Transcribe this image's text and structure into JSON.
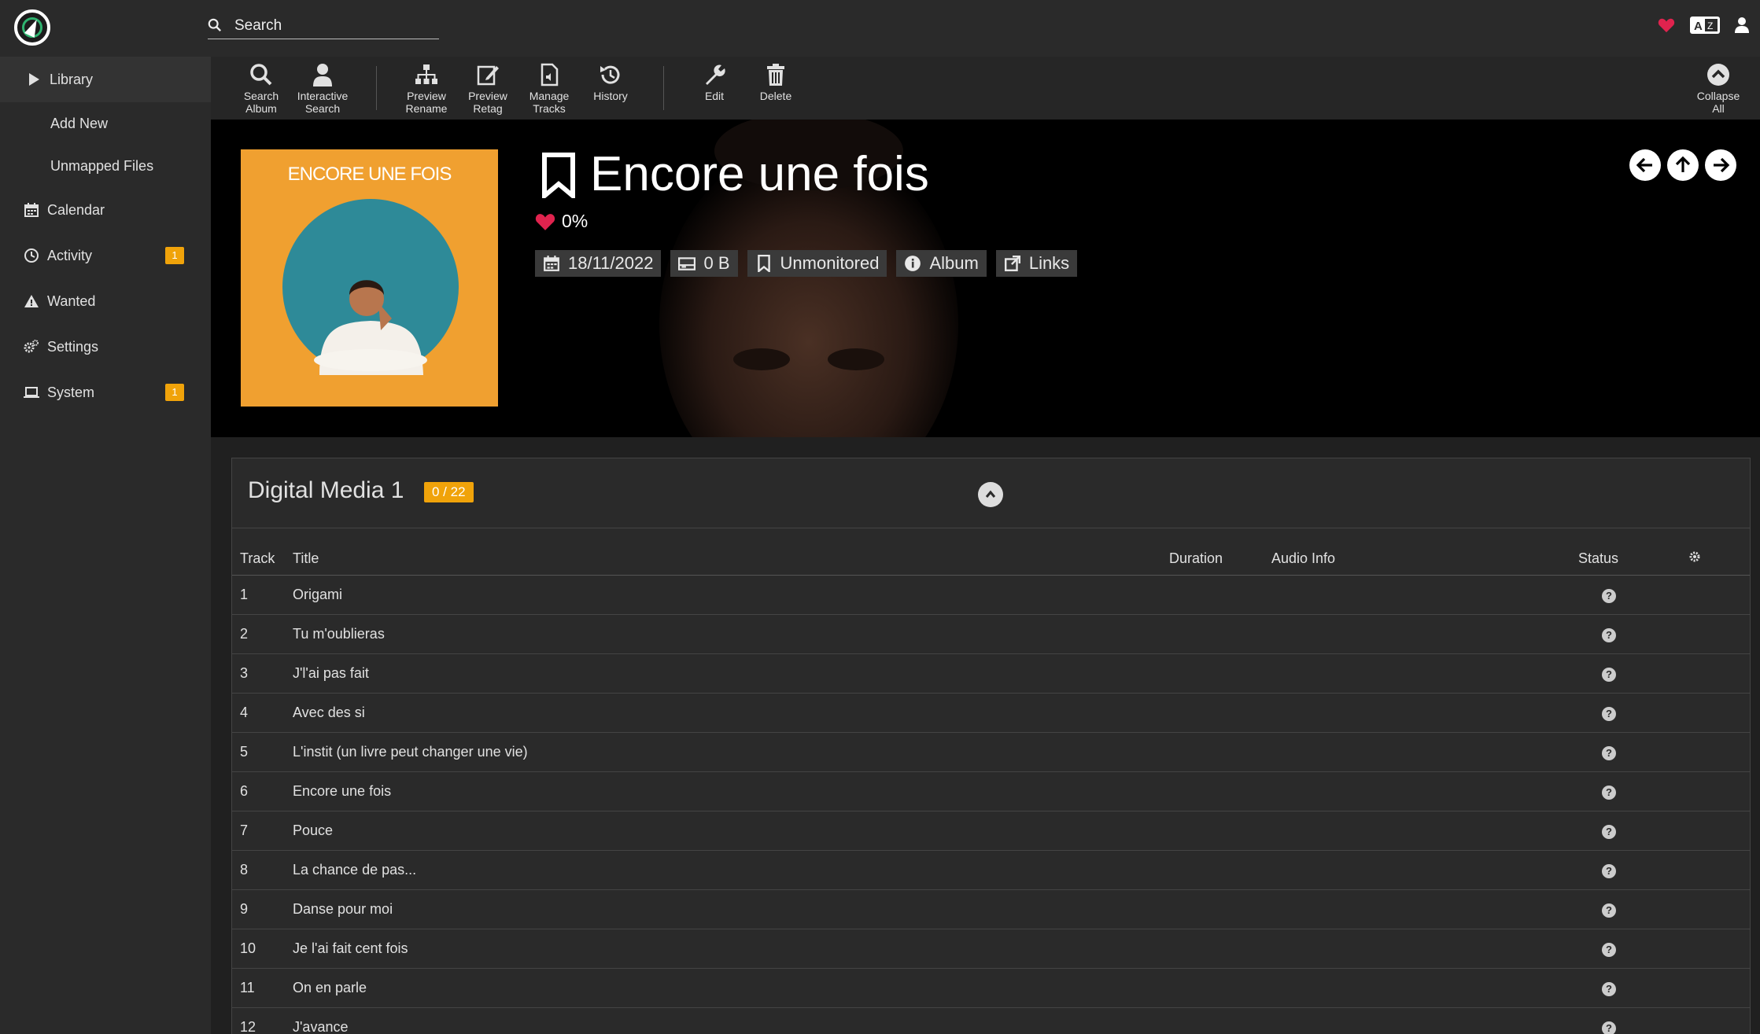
{
  "topbar": {
    "search_placeholder": "Search"
  },
  "sidebar": {
    "items": [
      {
        "label": "Library",
        "icon": "play-icon"
      },
      {
        "label": "Add New"
      },
      {
        "label": "Unmapped Files"
      },
      {
        "label": "Calendar",
        "icon": "calendar-icon"
      },
      {
        "label": "Activity",
        "icon": "clock-icon",
        "badge": "1"
      },
      {
        "label": "Wanted",
        "icon": "warning-icon"
      },
      {
        "label": "Settings",
        "icon": "cogs-icon"
      },
      {
        "label": "System",
        "icon": "laptop-icon",
        "badge": "1"
      }
    ]
  },
  "toolbar": {
    "search_album": [
      "Search",
      "Album"
    ],
    "interactive_search": [
      "Interactive",
      "Search"
    ],
    "preview_rename": [
      "Preview",
      "Rename"
    ],
    "preview_retag": [
      "Preview",
      "Retag"
    ],
    "manage_tracks": [
      "Manage",
      "Tracks"
    ],
    "history": "History",
    "edit": "Edit",
    "delete": "Delete",
    "collapse_all": [
      "Collapse",
      "All"
    ]
  },
  "album": {
    "cover_text": "ENCORE UNE FOIS",
    "title": "Encore une fois",
    "rating": "0%",
    "release_date": "18/11/2022",
    "size": "0 B",
    "monitor_status": "Unmonitored",
    "type": "Album",
    "links": "Links"
  },
  "medium": {
    "title": "Digital Media 1",
    "count": "0 / 22",
    "columns": [
      "Track",
      "Title",
      "Duration",
      "Audio Info",
      "Status"
    ],
    "tracks": [
      {
        "num": "1",
        "title": "Origami"
      },
      {
        "num": "2",
        "title": "Tu m'oublieras"
      },
      {
        "num": "3",
        "title": "J'l'ai pas fait"
      },
      {
        "num": "4",
        "title": "Avec des si"
      },
      {
        "num": "5",
        "title": "L'instit (un livre peut changer une vie)"
      },
      {
        "num": "6",
        "title": "Encore une fois"
      },
      {
        "num": "7",
        "title": "Pouce"
      },
      {
        "num": "8",
        "title": "La chance de pas..."
      },
      {
        "num": "9",
        "title": "Danse pour moi"
      },
      {
        "num": "10",
        "title": "Je l'ai fait cent fois"
      },
      {
        "num": "11",
        "title": "On en parle"
      },
      {
        "num": "12",
        "title": "J'avance"
      }
    ]
  },
  "colors": {
    "accent": "#f0a30a",
    "heart": "#e0234e",
    "background": "#202020"
  }
}
